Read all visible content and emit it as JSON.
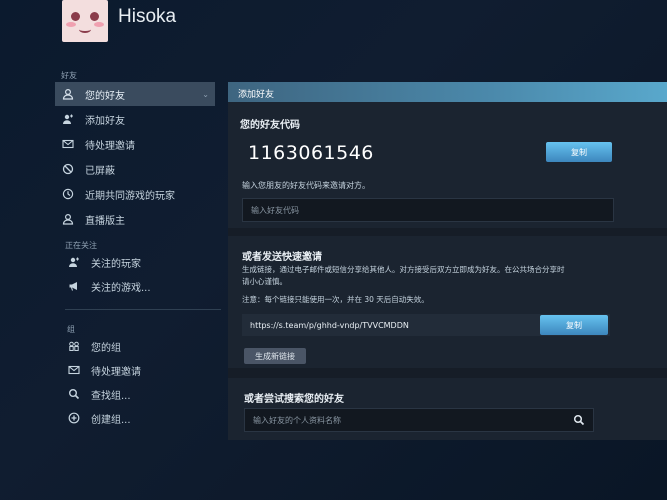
{
  "header": {
    "username": "Hisoka"
  },
  "sidebar": {
    "friends_title": "好友",
    "friends_items": [
      {
        "label": "您的好友",
        "icon": "person-icon"
      },
      {
        "label": "添加好友",
        "icon": "add-person-icon"
      },
      {
        "label": "待处理邀请",
        "icon": "mail-icon"
      },
      {
        "label": "已屏蔽",
        "icon": "block-icon"
      },
      {
        "label": "近期共同游戏的玩家",
        "icon": "clock-icon"
      },
      {
        "label": "直播版主",
        "icon": "person-icon"
      }
    ],
    "following_title": "正在关注",
    "following_items": [
      {
        "label": "关注的玩家",
        "icon": "add-person-icon"
      },
      {
        "label": "关注的游戏...",
        "icon": "megaphone-icon"
      }
    ],
    "groups_title": "组",
    "group_items": [
      {
        "label": "您的组",
        "icon": "group-icon"
      },
      {
        "label": "待处理邀请",
        "icon": "mail-icon"
      },
      {
        "label": "查找组...",
        "icon": "search-icon"
      },
      {
        "label": "创建组...",
        "icon": "plus-circle-icon"
      }
    ]
  },
  "main": {
    "panel_title": "添加好友",
    "friend_code_title": "您的好友代码",
    "friend_code": "1163061546",
    "copy_label": "复制",
    "enter_code_hint": "输入您朋友的好友代码来邀请对方。",
    "enter_code_placeholder": "输入好友代码",
    "quick_invite_title": "或者发送快速邀请",
    "quick_invite_desc_1": "生成链接，通过电子邮件或短信分享给其他人。对方接受后双方立即成为好友。在公共场合分享时",
    "quick_invite_desc_2": "请小心谨慎。",
    "quick_invite_note": "注意：每个链接只能使用一次，并在 30 天后自动失效。",
    "invite_link": "https://s.team/p/ghhd-vndp/TVVCMDDN",
    "copy_link_label": "复制",
    "generate_label": "生成新链接",
    "search_title": "或者尝试搜索您的好友",
    "search_placeholder": "输入好友的个人资料名称"
  }
}
